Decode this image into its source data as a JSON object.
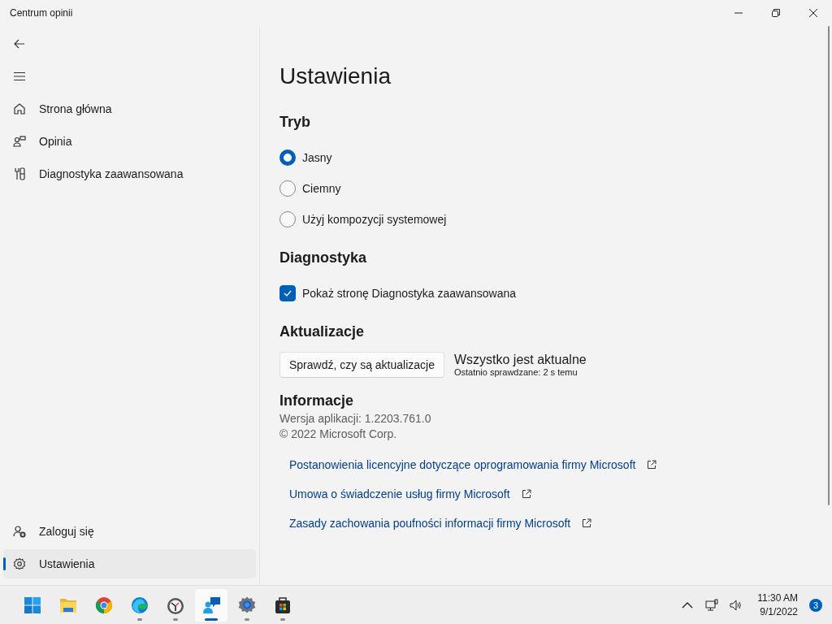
{
  "window": {
    "title": "Centrum opinii"
  },
  "sidebar": {
    "items": [
      {
        "kind": "home",
        "label": "Strona główna",
        "selected": false
      },
      {
        "kind": "feedback",
        "label": "Opinia",
        "selected": false
      },
      {
        "kind": "diagnostics",
        "label": "Diagnostyka zaawansowana",
        "selected": false
      }
    ],
    "footer_items": [
      {
        "kind": "signin",
        "label": "Zaloguj się",
        "selected": false
      },
      {
        "kind": "settings",
        "label": "Ustawienia",
        "selected": true
      }
    ]
  },
  "page": {
    "title": "Ustawienia",
    "mode": {
      "heading": "Tryb",
      "options": [
        {
          "label": "Jasny",
          "selected": true
        },
        {
          "label": "Ciemny",
          "selected": false
        },
        {
          "label": "Użyj kompozycji systemowej",
          "selected": false
        }
      ]
    },
    "diagnostics": {
      "heading": "Diagnostyka",
      "checkbox": {
        "label": "Pokaż stronę Diagnostyka zaawansowana",
        "checked": true
      }
    },
    "updates": {
      "heading": "Aktualizacje",
      "button": "Sprawdź, czy są aktualizacje",
      "status": "Wszystko jest aktualne",
      "last_checked": "Ostatnio sprawdzane: 2 s temu"
    },
    "about": {
      "heading": "Informacje",
      "version": "Wersja aplikacji: 1.2203.761.0",
      "copyright": "© 2022 Microsoft Corp.",
      "links": [
        "Postanowienia licencyjne dotyczące oprogramowania firmy Microsoft",
        "Umowa o świadczenie usług firmy Microsoft",
        "Zasady zachowania poufności informacji firmy Microsoft"
      ]
    }
  },
  "taskbar": {
    "apps": [
      {
        "kind": "start",
        "selected": false,
        "running": false
      },
      {
        "kind": "explorer",
        "selected": false,
        "running": false
      },
      {
        "kind": "chrome",
        "selected": false,
        "running": false
      },
      {
        "kind": "edge",
        "selected": false,
        "running": true
      },
      {
        "kind": "clock",
        "selected": false,
        "running": true
      },
      {
        "kind": "feedback",
        "selected": true,
        "running": true
      },
      {
        "kind": "settings",
        "selected": false,
        "running": true
      },
      {
        "kind": "store",
        "selected": false,
        "running": true
      }
    ],
    "time": "11:30 AM",
    "date": "9/1/2022",
    "notifications": "3"
  }
}
